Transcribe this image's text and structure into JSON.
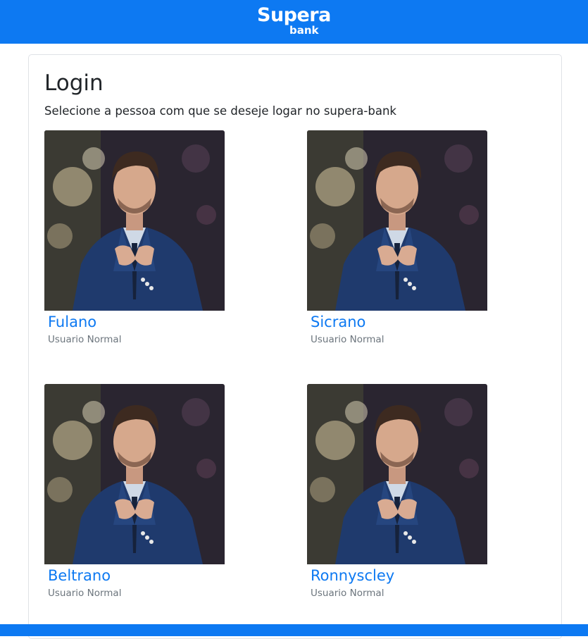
{
  "header": {
    "brand": "Supera",
    "brand_sub": "bank",
    "bg_color": "#0d79f2"
  },
  "main": {
    "title": "Login",
    "subtitle": "Selecione a pessoa com que se deseje logar no supera-bank"
  },
  "persons": [
    {
      "name": "Fulano",
      "role": "Usuario Normal",
      "photo": "man-in-suit-photo"
    },
    {
      "name": "Sicrano",
      "role": "Usuario Normal",
      "photo": "man-in-suit-photo"
    },
    {
      "name": "Beltrano",
      "role": "Usuario Normal",
      "photo": "man-in-suit-photo"
    },
    {
      "name": "Ronnyscley",
      "role": "Usuario Normal",
      "photo": "man-in-suit-photo"
    }
  ],
  "colors": {
    "link": "#0d79f2",
    "muted": "#6c757d"
  }
}
